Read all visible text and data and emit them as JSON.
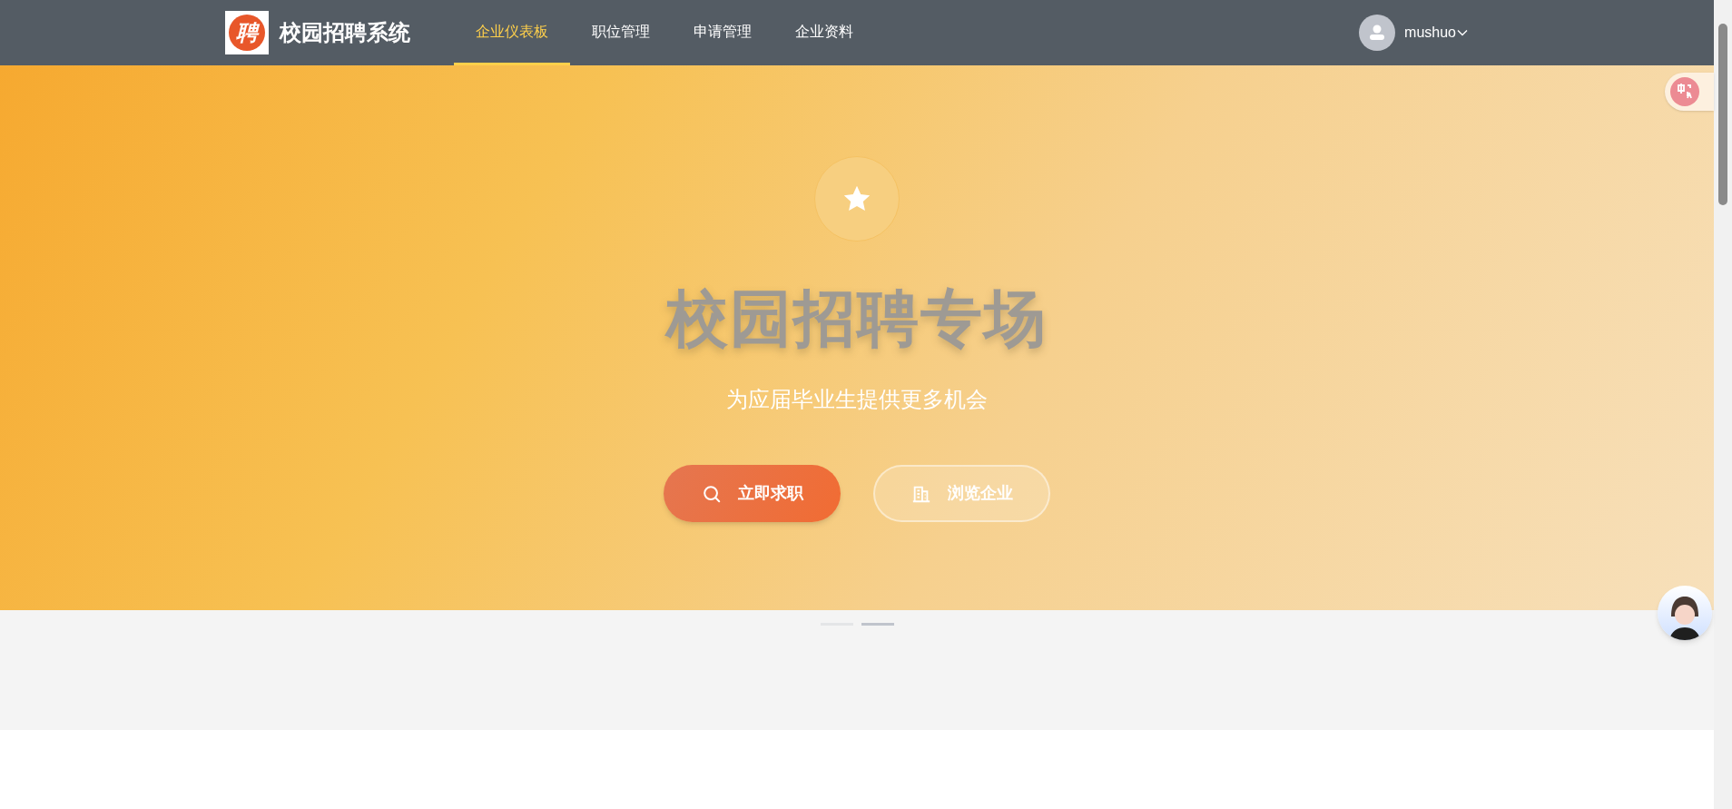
{
  "header": {
    "brand": {
      "logo_text": "聘",
      "title": "校园招聘系统"
    },
    "nav": [
      {
        "label": "企业仪表板",
        "selected": true
      },
      {
        "label": "职位管理",
        "selected": false
      },
      {
        "label": "申请管理",
        "selected": false
      },
      {
        "label": "企业资料",
        "selected": false
      }
    ],
    "user": {
      "name": "mushuo"
    }
  },
  "hero": {
    "title": "校园招聘专场",
    "subtitle": "为应届毕业生提供更多机会",
    "buttons": [
      {
        "kind": "primary",
        "label": "立即求职"
      },
      {
        "kind": "outline",
        "label": "浏览企业"
      }
    ]
  },
  "carousel": {
    "indicators": [
      {
        "selected": false
      },
      {
        "selected": true
      }
    ]
  }
}
